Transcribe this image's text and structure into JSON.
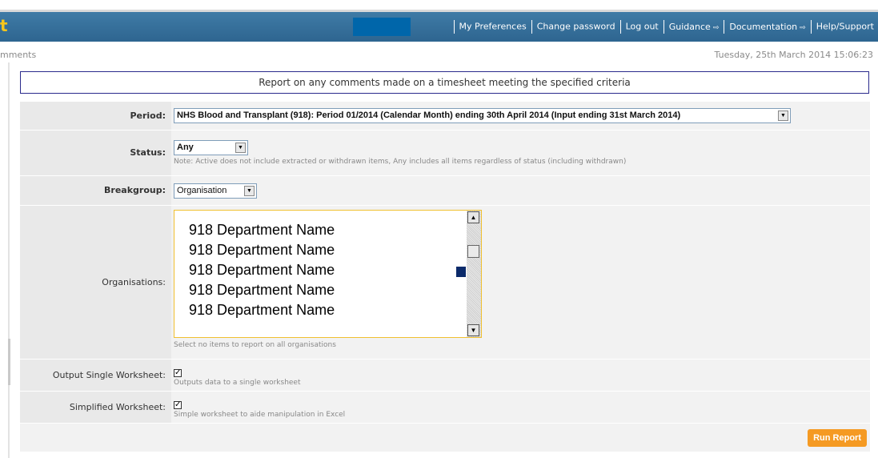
{
  "header": {
    "brand_fragment": "t",
    "links": [
      {
        "label": "My Preferences",
        "external": false
      },
      {
        "label": "Change password",
        "external": false
      },
      {
        "label": "Log out",
        "external": false
      },
      {
        "label": "Guidance",
        "external": true
      },
      {
        "label": "Documentation",
        "external": true
      },
      {
        "label": "Help/Support",
        "external": false
      }
    ],
    "external_icon": "⇨",
    "colors": {
      "bar": "#336b96",
      "brand": "#f6c51c",
      "user_block": "#0066aa"
    }
  },
  "subbar": {
    "breadcrumb": "mments",
    "datetime": "Tuesday, 25th March 2014 15:06:23"
  },
  "report": {
    "description": "Report on any comments made on a timesheet meeting the specified criteria"
  },
  "form": {
    "period": {
      "label": "Period:",
      "value": "NHS Blood and Transplant (918): Period 01/2014 (Calendar Month) ending 30th April 2014 (Input ending 31st March 2014)"
    },
    "status": {
      "label": "Status:",
      "value": "Any",
      "note": "Note: Active does not include extracted or withdrawn items, Any includes all items regardless of status (including withdrawn)"
    },
    "breakgroup": {
      "label": "Breakgroup:",
      "value": "Organisation"
    },
    "organisations": {
      "label": "Organisations:",
      "items": [
        "918 Department Name",
        "918 Department Name",
        "918 Department Name",
        "918 Department Name",
        "918 Department Name"
      ],
      "note": "Select no items to report on all organisations"
    },
    "output_single": {
      "label": "Output Single Worksheet:",
      "checked": true,
      "note": "Outputs data to a single worksheet"
    },
    "simplified": {
      "label": "Simplified Worksheet:",
      "checked": true,
      "note": "Simple worksheet to aide manipulation in Excel"
    },
    "run_label": "Run Report",
    "run_color": "#f59a23"
  }
}
